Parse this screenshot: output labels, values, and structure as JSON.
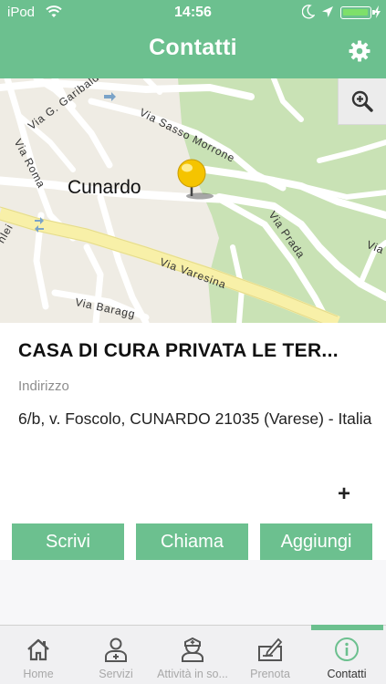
{
  "status_bar": {
    "carrier": "iPod",
    "time": "14:56",
    "battery_color": "#7ee06a"
  },
  "header": {
    "title": "Contatti",
    "settings_icon": "gear-icon",
    "background": "#6cc08f"
  },
  "map": {
    "zoom_icon": "zoom-in-icon",
    "marker_icon": "map-pin-icon",
    "town": "Cunardo",
    "streets": {
      "garibaldi": "Via G. Garibaldi",
      "sasso_morrone": "Via Sasso Morrone",
      "roma": "Via Roma",
      "prada": "Via Prada",
      "varesina": "Via Varesina",
      "baragg": "Via Baragg",
      "left_edge": "nlei",
      "right_edge": "Via"
    }
  },
  "contact": {
    "name": "CASA DI CURA PRIVATA LE TER...",
    "address_label": "Indirizzo",
    "address": "6/b, v. Foscolo, CUNARDO 21035 (Varese) - Italia",
    "expand_label": "+"
  },
  "actions": {
    "write": "Scrivi",
    "call": "Chiama",
    "add": "Aggiungi",
    "accent": "#6cc08f"
  },
  "tabs": [
    {
      "label": "Home",
      "icon": "home-icon"
    },
    {
      "label": "Servizi",
      "icon": "doctor-icon"
    },
    {
      "label": "Attività in so...",
      "icon": "nurse-icon"
    },
    {
      "label": "Prenota",
      "icon": "booking-icon"
    },
    {
      "label": "Contatti",
      "icon": "info-icon",
      "active": true
    }
  ]
}
